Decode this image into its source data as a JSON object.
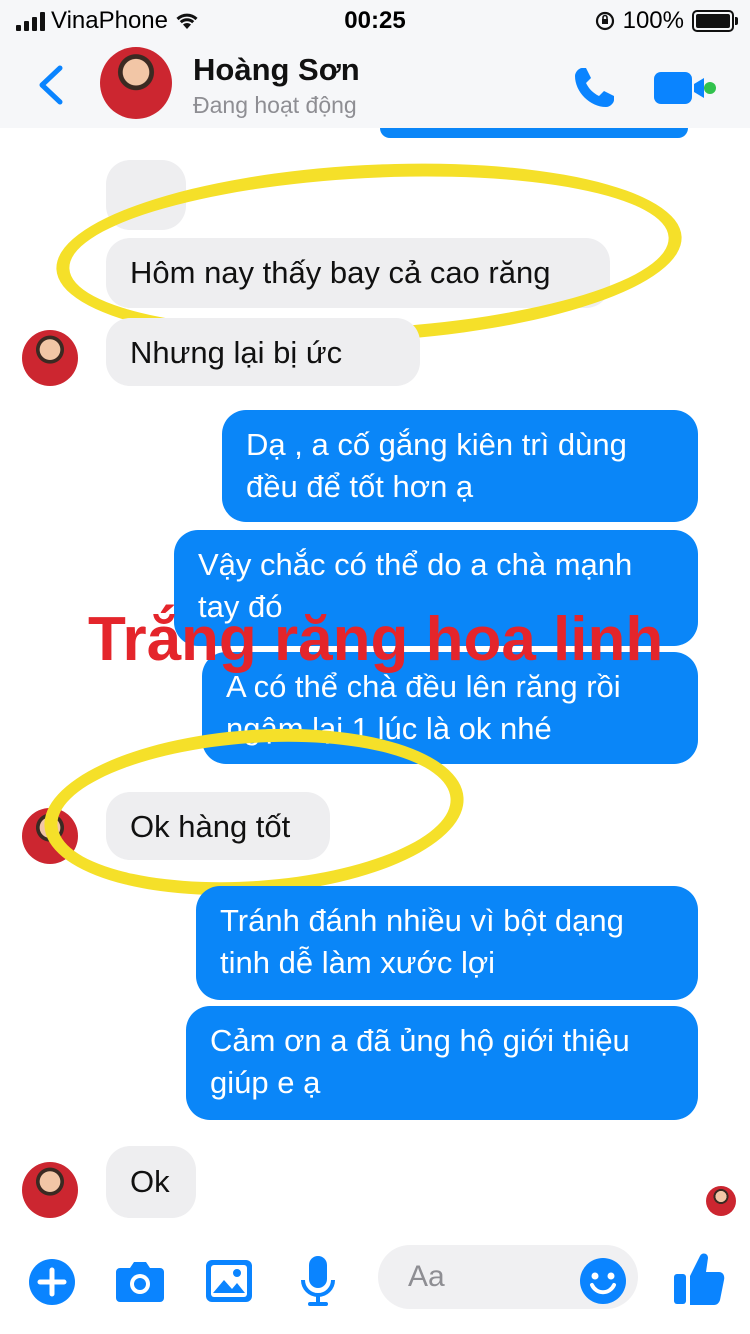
{
  "status_bar": {
    "carrier": "VinaPhone",
    "time": "00:25",
    "battery": "100%"
  },
  "header": {
    "contact_name": "Hoàng Sơn",
    "presence": "Đang hoạt động"
  },
  "messages": [
    {
      "from": "them",
      "text": "Hôm nay thấy bay cả cao răng"
    },
    {
      "from": "them",
      "text": "Nhưng lại bị ức ...",
      "partial": "Nhưng lại bị ức"
    },
    {
      "from": "me",
      "lines": [
        "Dạ , a cố gắng kiên trì dùng",
        "đều để tốt hơn ạ"
      ]
    },
    {
      "from": "me",
      "lines": [
        "Vậy chắc có thể do a chà mạnh",
        "tay đó"
      ]
    },
    {
      "from": "me",
      "lines": [
        "A có thể chà đều lên răng rồi",
        "ngậm lại 1 lúc là ok nhé"
      ]
    },
    {
      "from": "them",
      "text": "Ok hàng tốt"
    },
    {
      "from": "me",
      "lines": [
        "Tránh đánh nhiều vì bột dạng",
        "tinh dễ làm xước lợi"
      ]
    },
    {
      "from": "me",
      "lines": [
        "Cảm ơn a đã ủng hộ giới thiệu",
        "giúp e ạ"
      ]
    },
    {
      "from": "them",
      "text": "Ok"
    }
  ],
  "watermark": "Trắng răng hoa linh",
  "composer": {
    "placeholder": "Aa"
  },
  "icons": [
    "back-chevron-icon",
    "phone-icon",
    "video-camera-icon",
    "plus-icon",
    "camera-icon",
    "image-icon",
    "microphone-icon",
    "emoji-icon",
    "thumbs-up-icon"
  ],
  "colors": {
    "accent": "#0a84ff",
    "outgoing_bubble": "#0a86f8",
    "incoming_bubble": "#eeeef0",
    "highlight": "#f5e029",
    "watermark": "#e4252b",
    "online_dot": "#31c24d"
  }
}
